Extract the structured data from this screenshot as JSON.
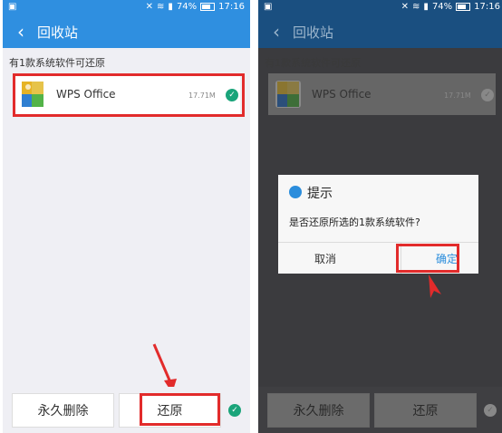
{
  "statusbar": {
    "battery": "74%",
    "time": "17:16"
  },
  "appbar": {
    "title": "回收站"
  },
  "subtitle": "有1款系统软件可还原",
  "app": {
    "name": "WPS Office",
    "size": "17.71M"
  },
  "buttons": {
    "delete": "永久删除",
    "restore": "还原"
  },
  "dialog": {
    "title": "提示",
    "message": "是否还原所选的1款系统软件?",
    "cancel": "取消",
    "confirm": "确定"
  },
  "colors": {
    "primary": "#2f8fe0",
    "check": "#1aa47a",
    "highlight": "#e22b2b"
  }
}
